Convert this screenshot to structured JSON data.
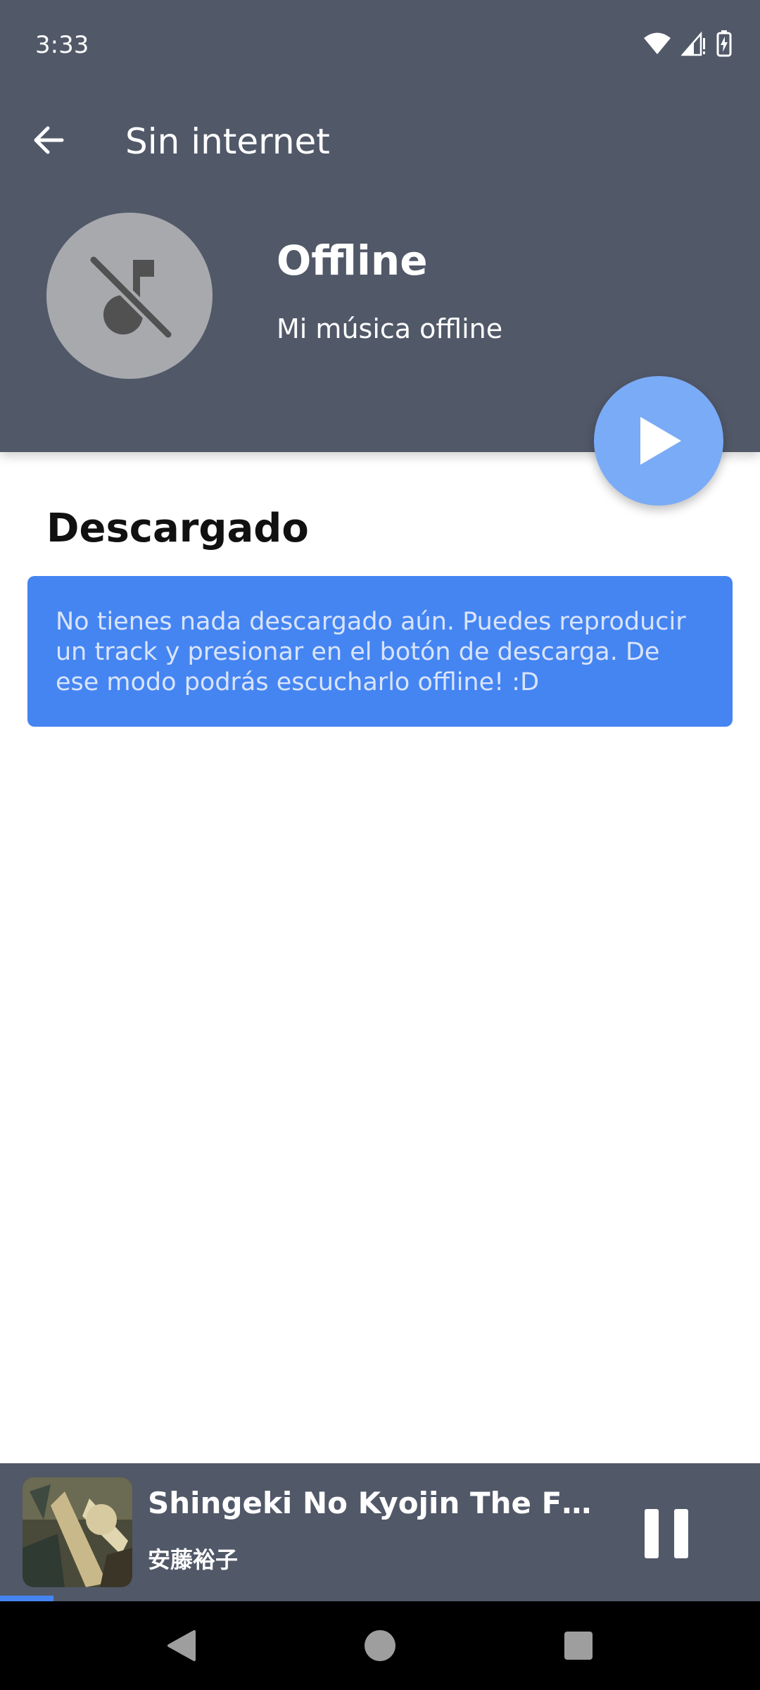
{
  "status_bar": {
    "time": "3:33",
    "icons": [
      "wifi-icon",
      "signal-icon",
      "battery-charging-icon"
    ]
  },
  "toolbar": {
    "back_icon": "arrow-back-icon",
    "title": "Sin internet"
  },
  "playlist": {
    "cover_icon": "music-off-icon",
    "name": "Offline",
    "description": "Mi música offline",
    "play_icon": "play-icon"
  },
  "section": {
    "title": "Descargado",
    "empty_message": "No tienes nada descargado aún. Puedes reproducir un track y presionar en el botón de descarga. De ese modo podrás escucharlo offline! :D"
  },
  "mini_player": {
    "track_title": "Shingeki No Kyojin The Final Season",
    "artist": "安藤裕子",
    "pause_icon": "pause-icon",
    "progress": 0.07
  },
  "nav_bar": {
    "icons": [
      "back-triangle-icon",
      "home-circle-icon",
      "recents-square-icon"
    ]
  },
  "colors": {
    "header_bg": "#515868",
    "accent": "#4585f2",
    "fab": "#7aabf6"
  }
}
